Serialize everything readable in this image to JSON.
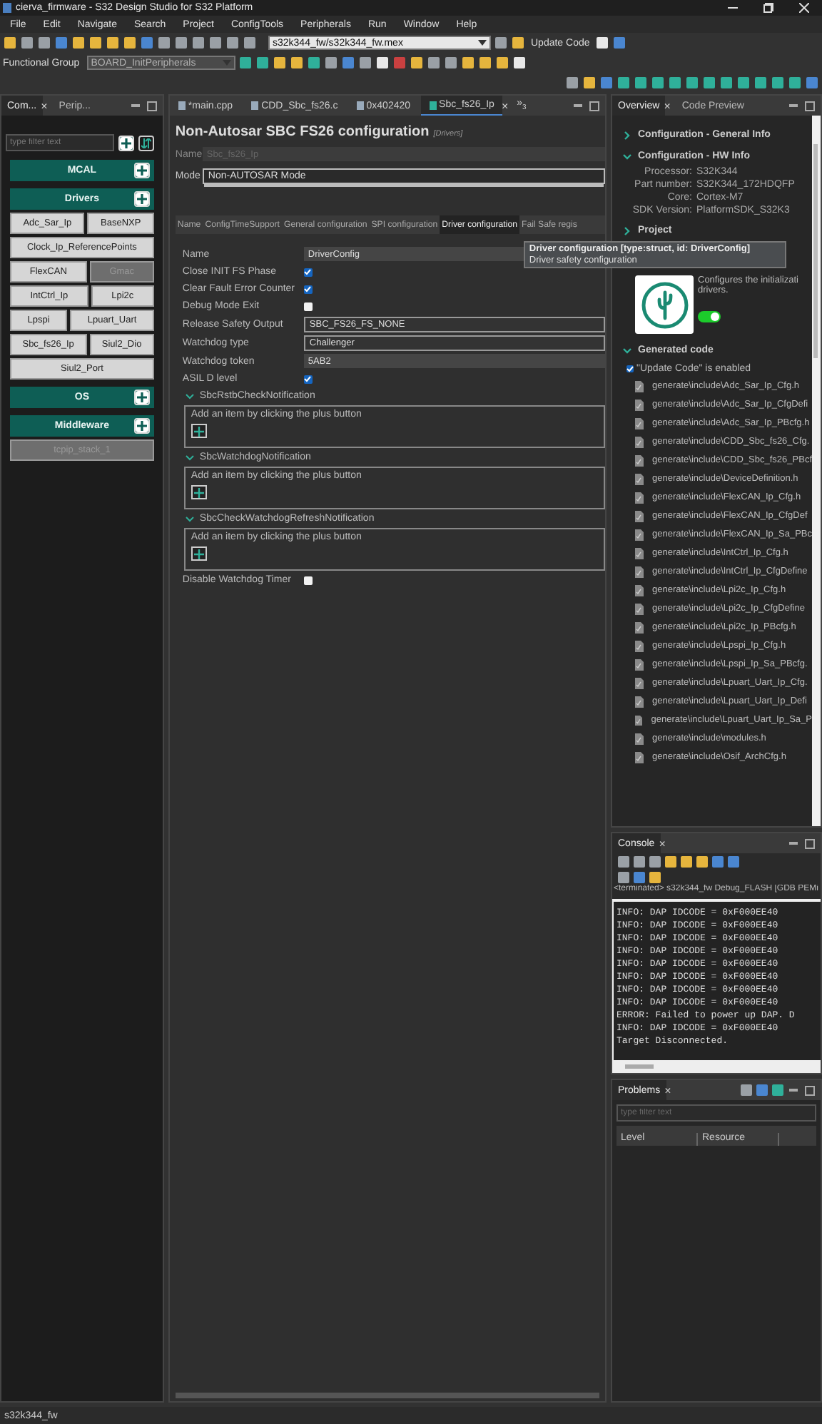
{
  "window": {
    "title": "cierva_firmware - S32 Design Studio for S32 Platform"
  },
  "menu": [
    "File",
    "Edit",
    "Navigate",
    "Search",
    "Project",
    "ConfigTools",
    "Peripherals",
    "Run",
    "Window",
    "Help"
  ],
  "toolbar": {
    "config_file": "s32k344_fw/s32k344_fw.mex",
    "update_button": "Update Code",
    "functional_group_label": "Functional Group",
    "functional_group": "BOARD_InitPeripherals",
    "functional_group_disabled": true
  },
  "left_panel": {
    "tabs": [
      {
        "label": "Com...",
        "selected": true,
        "close": "×"
      },
      {
        "label": "Perip...",
        "selected": false
      }
    ],
    "filter": {
      "placeholder": "type filter text"
    },
    "groups": [
      {
        "label": "MCAL"
      },
      {
        "label": "Drivers",
        "rows": [
          [
            {
              "label": "Adc_Sar_Ip",
              "disabled": false
            },
            {
              "label": "BaseNXP",
              "disabled": false
            }
          ],
          [
            {
              "label": "Clock_Ip_ReferencePoints",
              "disabled": false
            }
          ],
          [
            {
              "label": "FlexCAN",
              "disabled": false
            },
            {
              "label": "Gmac",
              "disabled": true
            }
          ],
          [
            {
              "label": "IntCtrl_Ip",
              "disabled": false
            },
            {
              "label": "Lpi2c",
              "disabled": false
            }
          ],
          [
            {
              "label": "Lpspi",
              "disabled": false
            },
            {
              "label": "Lpuart_Uart",
              "disabled": false
            }
          ],
          [
            {
              "label": "Sbc_fs26_Ip",
              "disabled": false
            },
            {
              "label": "Siul2_Dio",
              "disabled": false
            }
          ],
          [
            {
              "label": "Siul2_Port",
              "disabled": false
            }
          ]
        ]
      },
      {
        "label": "OS"
      },
      {
        "label": "Middleware",
        "rows": [
          [
            {
              "label": "tcpip_stack_1",
              "disabled": true
            }
          ]
        ]
      }
    ]
  },
  "editor": {
    "tabs": [
      {
        "label": "*main.cpp",
        "selected": false
      },
      {
        "label": "CDD_Sbc_fs26.c",
        "selected": false
      },
      {
        "label": "0x402420",
        "selected": false
      },
      {
        "label": "Sbc_fs26_Ip",
        "selected": true,
        "close": "×"
      }
    ],
    "overflow": {
      "symbol": "»",
      "count": "3"
    },
    "heading": "Non-Autosar SBC FS26 configuration",
    "category": "[Drivers]",
    "name_label": "Name",
    "name_value": "Sbc_fs26_Ip",
    "mode_label": "Mode",
    "mode_value": "Non-AUTOSAR Mode",
    "subtabs": [
      {
        "label": "Name",
        "selected": false
      },
      {
        "label": "ConfigTimeSupport",
        "selected": false
      },
      {
        "label": "General configuration",
        "selected": false
      },
      {
        "label": "SPI configuration",
        "selected": false
      },
      {
        "label": "Driver configuration",
        "selected": true
      },
      {
        "label": "Fail Safe regis",
        "selected": false
      }
    ],
    "rows": [
      {
        "kind": "field",
        "label": "Name",
        "value": "DriverConfig"
      },
      {
        "kind": "checkbox",
        "label": "Close INIT FS Phase",
        "checked": true
      },
      {
        "kind": "checkbox",
        "label": "Clear Fault Error Counter",
        "checked": true
      },
      {
        "kind": "checkbox",
        "label": "Debug Mode Exit",
        "checked": false
      },
      {
        "kind": "select",
        "label": "Release Safety Output",
        "value": "SBC_FS26_FS_NONE"
      },
      {
        "kind": "select",
        "label": "Watchdog type",
        "value": "Challenger"
      },
      {
        "kind": "field",
        "label": "Watchdog token",
        "value": "5AB2"
      },
      {
        "kind": "checkbox",
        "label": "ASIL D level",
        "checked": true
      },
      {
        "kind": "section",
        "label": "SbcRstbCheckNotification",
        "hint": "Add an item by clicking the plus button"
      },
      {
        "kind": "section",
        "label": "SbcWatchdogNotification",
        "hint": "Add an item by clicking the plus button"
      },
      {
        "kind": "section",
        "label": "SbcCheckWatchdogRefreshNotification",
        "hint": "Add an item by clicking the plus button"
      },
      {
        "kind": "checkbox",
        "label": "Disable Watchdog Timer",
        "checked": false
      }
    ],
    "tooltip": {
      "title": "Driver configuration [type:struct, id: DriverConfig]",
      "text": "Driver safety configuration"
    }
  },
  "overview": {
    "tabs": [
      {
        "label": "Overview",
        "selected": true,
        "close": "×"
      },
      {
        "label": "Code Preview",
        "selected": false
      }
    ],
    "sections": [
      {
        "title": "Configuration - General Info",
        "expanded": false
      },
      {
        "title": "Configuration - HW Info",
        "expanded": true,
        "properties": [
          {
            "key": "Processor:",
            "value": "S32K344"
          },
          {
            "key": "Part number:",
            "value": "S32K344_172HDQFP"
          },
          {
            "key": "Core:",
            "value": "Cortex-M7"
          },
          {
            "key": "SDK Version:",
            "value": "PlatformSDK_S32K3"
          }
        ]
      },
      {
        "title": "Project",
        "expanded": false
      }
    ],
    "component": {
      "lines": [
        "Configures the initializati",
        "drivers."
      ],
      "enabled": true
    },
    "generated": {
      "title": "Generated code",
      "expanded": true,
      "update_label": "\"Update Code\" is enabled",
      "update_checked": true,
      "files": [
        "generate\\include\\Adc_Sar_Ip_Cfg.h",
        "generate\\include\\Adc_Sar_Ip_CfgDefi",
        "generate\\include\\Adc_Sar_Ip_PBcfg.h",
        "generate\\include\\CDD_Sbc_fs26_Cfg.",
        "generate\\include\\CDD_Sbc_fs26_PBcf",
        "generate\\include\\DeviceDefinition.h",
        "generate\\include\\FlexCAN_Ip_Cfg.h",
        "generate\\include\\FlexCAN_Ip_CfgDef",
        "generate\\include\\FlexCAN_Ip_Sa_PBc",
        "generate\\include\\IntCtrl_Ip_Cfg.h",
        "generate\\include\\IntCtrl_Ip_CfgDefine",
        "generate\\include\\Lpi2c_Ip_Cfg.h",
        "generate\\include\\Lpi2c_Ip_CfgDefine",
        "generate\\include\\Lpi2c_Ip_PBcfg.h",
        "generate\\include\\Lpspi_Ip_Cfg.h",
        "generate\\include\\Lpspi_Ip_Sa_PBcfg.",
        "generate\\include\\Lpuart_Uart_Ip_Cfg.",
        "generate\\include\\Lpuart_Uart_Ip_Defi",
        "generate\\include\\Lpuart_Uart_Ip_Sa_P",
        "generate\\include\\modules.h",
        "generate\\include\\Osif_ArchCfg.h"
      ]
    }
  },
  "console": {
    "tab": {
      "label": "Console",
      "close": "×"
    },
    "status": "<terminated> s32k344_fw Debug_FLASH [GDB PEMi",
    "lines": [
      "INFO: DAP IDCODE = 0xF000EE40",
      "INFO: DAP IDCODE = 0xF000EE40",
      "INFO: DAP IDCODE = 0xF000EE40",
      "INFO: DAP IDCODE = 0xF000EE40",
      "INFO: DAP IDCODE = 0xF000EE40",
      "INFO: DAP IDCODE = 0xF000EE40",
      "INFO: DAP IDCODE = 0xF000EE40",
      "INFO: DAP IDCODE = 0xF000EE40",
      "ERROR: Failed to power up DAP. D",
      "INFO: DAP IDCODE = 0xF000EE40",
      "Target Disconnected."
    ]
  },
  "problems": {
    "tab": {
      "label": "Problems",
      "close": "×"
    },
    "filter": {
      "placeholder": "type filter text"
    },
    "columns": [
      "Level",
      "Resource"
    ]
  },
  "status_bar": "s32k344_fw"
}
